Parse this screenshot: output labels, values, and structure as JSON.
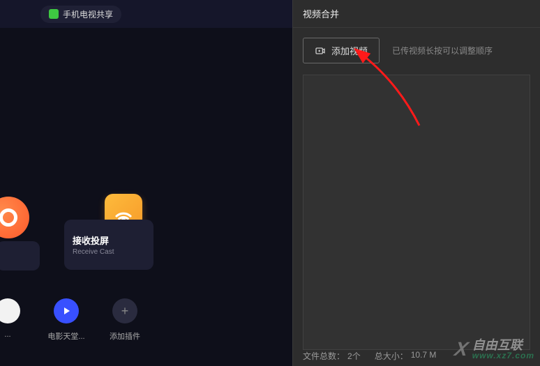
{
  "titlebar": {
    "share_label": "手机电视共享"
  },
  "cast_card": {
    "title": "接收投屏",
    "subtitle": "Receive Cast"
  },
  "shortcuts": [
    {
      "label": "..."
    },
    {
      "label": "电影天堂..."
    },
    {
      "label": "添加插件"
    }
  ],
  "right_panel": {
    "title": "视频合并",
    "add_button": "添加视频",
    "hint": "已传视频长按可以调整顺序",
    "footer_count_label": "文件总数：",
    "footer_count_value": "2个",
    "footer_size_label": "总大小：",
    "footer_size_value": "10.7 M"
  },
  "watermark": {
    "main": "自由互联",
    "url": "www.xz7.com"
  }
}
